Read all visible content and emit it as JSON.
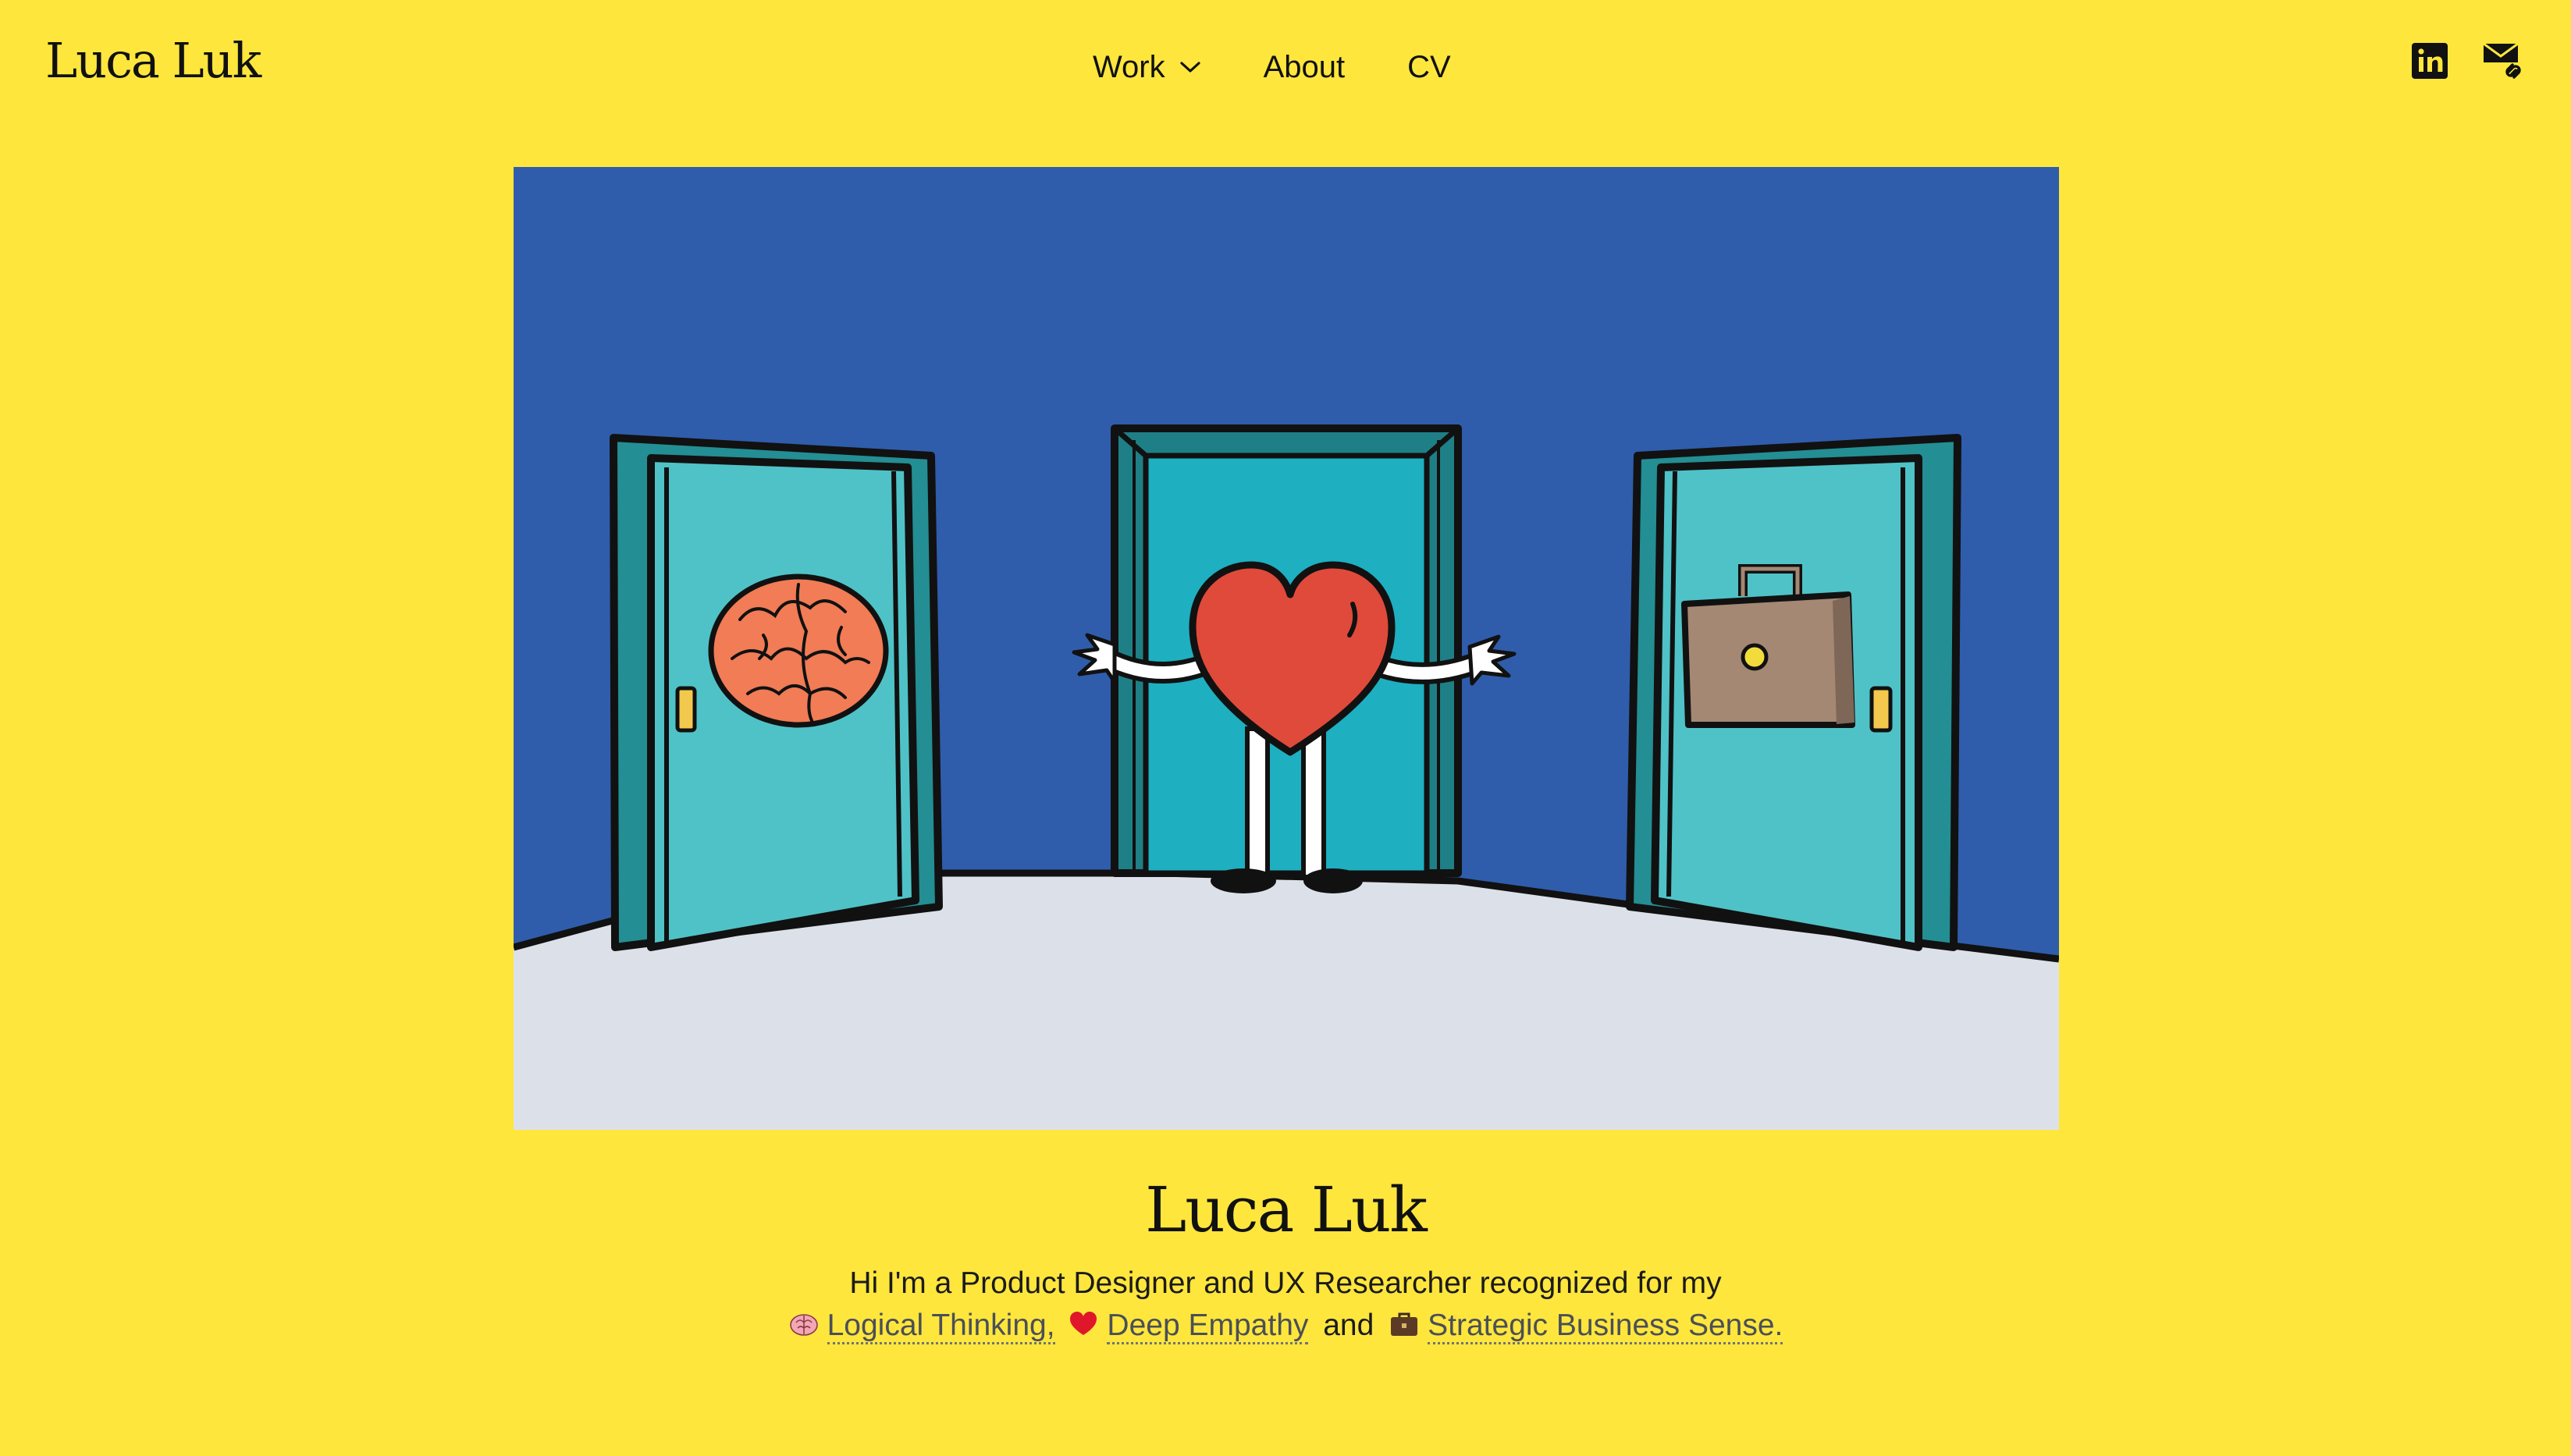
{
  "theme": {
    "background": "#FFE63D",
    "hero_wall": "#2F5DAB",
    "hero_floor": "#DCE1E9",
    "door_color": "#4FC2C7",
    "heart_color": "#E04A3A",
    "brain_color": "#F17C55",
    "briefcase_color": "#A48873"
  },
  "header": {
    "logo": "Luca Luk",
    "nav": [
      {
        "label": "Work",
        "has_dropdown": true
      },
      {
        "label": "About"
      },
      {
        "label": "CV"
      }
    ],
    "social_icons": [
      "linkedin-icon",
      "email-link-icon"
    ]
  },
  "hero_image": {
    "description_icons": [
      "brain-door",
      "heart-character-open-door",
      "briefcase-door"
    ]
  },
  "intro": {
    "name": "Luca Luk",
    "line1": "Hi I'm a Product Designer and UX Researcher recognized for my",
    "traits": [
      {
        "icon": "brain-emoji",
        "label": "Logical Thinking,"
      },
      {
        "icon": "heart-emoji",
        "label": "Deep Empathy"
      },
      {
        "icon": "briefcase-emoji",
        "label": "Strategic Business Sense."
      }
    ],
    "connector": "and"
  }
}
